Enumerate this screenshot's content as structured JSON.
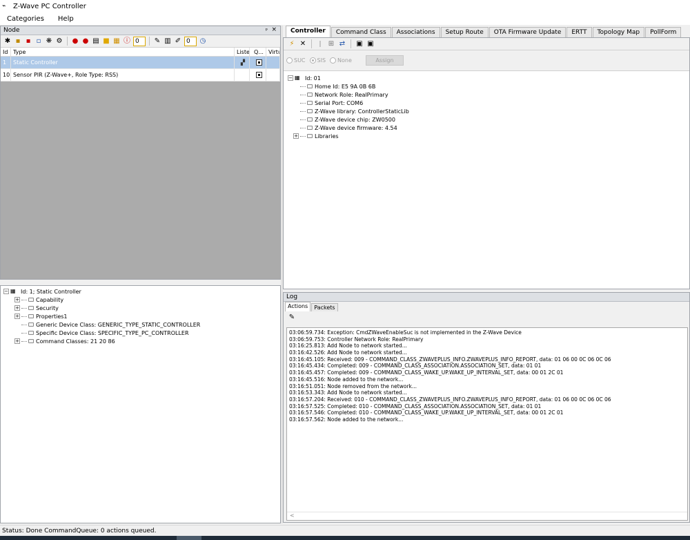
{
  "window": {
    "title": "Z-Wave PC Controller"
  },
  "menu": [
    "Categories",
    "Help"
  ],
  "node_panel": {
    "title": "Node",
    "pin_glyph": "📌",
    "toolbar_counts": [
      "0",
      "0"
    ],
    "columns": [
      "Id",
      "Type",
      "Liste",
      "Q...",
      "Virtu"
    ],
    "rows": [
      {
        "id": "1",
        "type": "Static Controller",
        "selected": true
      },
      {
        "id": "10",
        "type": "Sensor PIR (Z-Wave+, Role Type: RSS)",
        "selected": false
      }
    ]
  },
  "node_tree": {
    "root": "Id: 1; Static Controller",
    "items": [
      {
        "label": "Capability",
        "expandable": true
      },
      {
        "label": "Security",
        "expandable": true
      },
      {
        "label": "Properties1",
        "expandable": true
      },
      {
        "label": "Generic Device Class: GENERIC_TYPE_STATIC_CONTROLLER",
        "expandable": false
      },
      {
        "label": "Specific Device Class: SPECIFIC_TYPE_PC_CONTROLLER",
        "expandable": false
      },
      {
        "label": "Command Classes: 21 20 86",
        "expandable": true
      }
    ]
  },
  "right_tabs": [
    "Controller",
    "Command Class",
    "Associations",
    "Setup Route",
    "OTA Firmware Update",
    "ERTT",
    "Topology Map",
    "PollForm"
  ],
  "controller": {
    "roles": [
      "SUC",
      "SIS",
      "None"
    ],
    "assign_label": "Assign",
    "tree_root": "Id: 01",
    "tree_items": [
      {
        "label": "Home Id: E5 9A 0B 6B",
        "expandable": false
      },
      {
        "label": "Network Role: RealPrimary",
        "expandable": false
      },
      {
        "label": "Serial Port: COM6",
        "expandable": false
      },
      {
        "label": "Z-Wave library: ControllerStaticLib",
        "expandable": false
      },
      {
        "label": "Z-Wave device chip: ZW0500",
        "expandable": false
      },
      {
        "label": "Z-Wave device firmware:  4.54",
        "expandable": false
      },
      {
        "label": "Libraries",
        "expandable": true
      }
    ]
  },
  "log": {
    "title": "Log",
    "tabs": [
      "Actions",
      "Packets"
    ],
    "lines": [
      "03:06:59.734: Exception: CmdZWaveEnableSuc is not implemented in the Z-Wave Device",
      "03:06:59.753: Controller Network Role: RealPrimary",
      "03:16:25.813: Add Node to network started...",
      "03:16:42.526: Add Node to network started...",
      "03:16:45.105: Received: 009 - COMMAND_CLASS_ZWAVEPLUS_INFO.ZWAVEPLUS_INFO_REPORT, data: 01 06 00 0C 06 0C 06",
      "03:16:45.434: Completed: 009 - COMMAND_CLASS_ASSOCIATION.ASSOCIATION_SET, data: 01 01",
      "03:16:45.457: Completed: 009 - COMMAND_CLASS_WAKE_UP.WAKE_UP_INTERVAL_SET, data: 00 01 2C 01",
      "03:16:45.516: Node added to the network...",
      "03:16:51.051: Node removed from the network...",
      "03:16:53.343: Add Node to network started...",
      "03:16:57.204: Received: 010 - COMMAND_CLASS_ZWAVEPLUS_INFO.ZWAVEPLUS_INFO_REPORT, data: 01 06 00 0C 06 0C 06",
      "03:16:57.525: Completed: 010 - COMMAND_CLASS_ASSOCIATION.ASSOCIATION_SET, data: 01 01",
      "03:16:57.546: Completed: 010 - COMMAND_CLASS_WAKE_UP.WAKE_UP_INTERVAL_SET, data: 00 01 2C 01",
      "03:16:57.562: Node added to the network..."
    ],
    "scroll_glyph": "<"
  },
  "status": {
    "text": "Status: Done  CommandQueue: 0 actions queued."
  },
  "colors": {
    "selected_row": "#aec9e8",
    "node_grid_bg": "#ababab",
    "taskbar": "#1f2b38"
  }
}
